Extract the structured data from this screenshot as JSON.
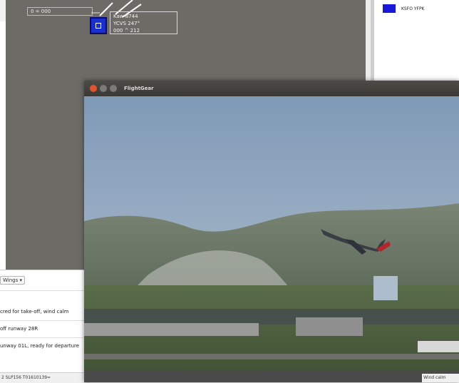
{
  "radar": {
    "readout": "0 = 000",
    "datablock": [
      "Kaw 8744",
      "YCVS 247°",
      "000 ^ 212"
    ]
  },
  "flight_strip": {
    "label": "KSFO YFPK",
    "color": "#1818d8"
  },
  "atc_list": {
    "wings_button": "Wings",
    "messages": [
      "cred for take-off, wind calm",
      "off runway 28R",
      "unway 01L, ready for departure"
    ],
    "metar": "2 SLP156 T01610139="
  },
  "flightgear": {
    "title": "FlightGear",
    "wind_status": "Wind calm"
  },
  "colors": {
    "radar_bg": "#6d6b66",
    "sky_top": "#7f9ab7",
    "sky_bottom": "#b7c3cf"
  }
}
